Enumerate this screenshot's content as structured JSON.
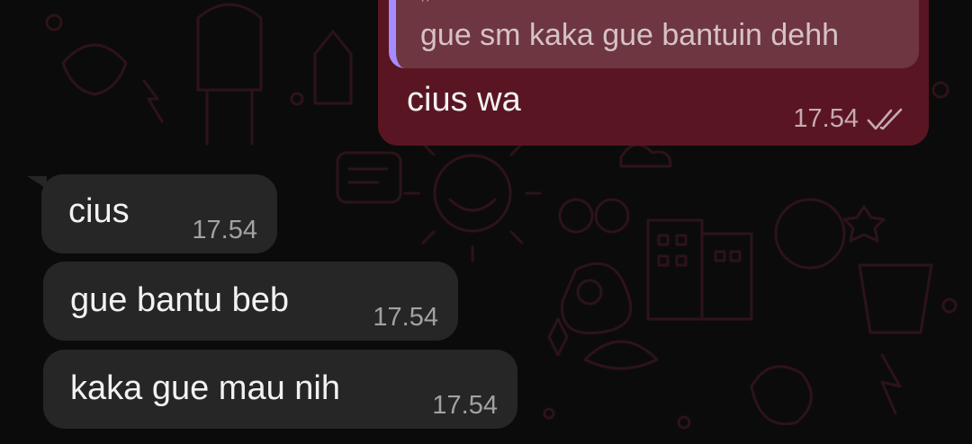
{
  "colors": {
    "background": "#0b0b0b",
    "outgoing_bubble": "#5a1523",
    "incoming_bubble": "#262626",
    "quote_bar": "#a58cff"
  },
  "outgoing": {
    "quote_text": "gue sm kaka gue bantuin dehh",
    "quote_partial_top": ",,",
    "message": "cius wa",
    "time": "17.54",
    "status_icon": "double-check-icon"
  },
  "incoming": [
    {
      "text": "cius",
      "time": "17.54"
    },
    {
      "text": "gue bantu beb",
      "time": "17.54"
    },
    {
      "text": "kaka gue mau nih",
      "time": "17.54"
    }
  ]
}
